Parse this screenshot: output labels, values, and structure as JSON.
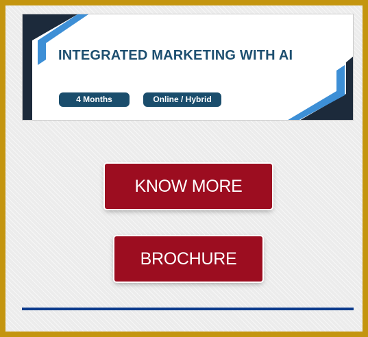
{
  "banner": {
    "title": "INTEGRATED MARKETING WITH AI",
    "tags": [
      "4 Months",
      "Online / Hybrid"
    ]
  },
  "actions": {
    "know_more_label": "KNOW MORE",
    "brochure_label": "BROCHURE"
  },
  "colors": {
    "frame_border": "#c4950f",
    "title_text": "#1d4f70",
    "chip_background": "#1a4d6c",
    "button_background": "#9c0d20",
    "divider": "#0b3a8c",
    "accent_dark": "#1c2a3b",
    "accent_light": "#3d8fd6"
  }
}
